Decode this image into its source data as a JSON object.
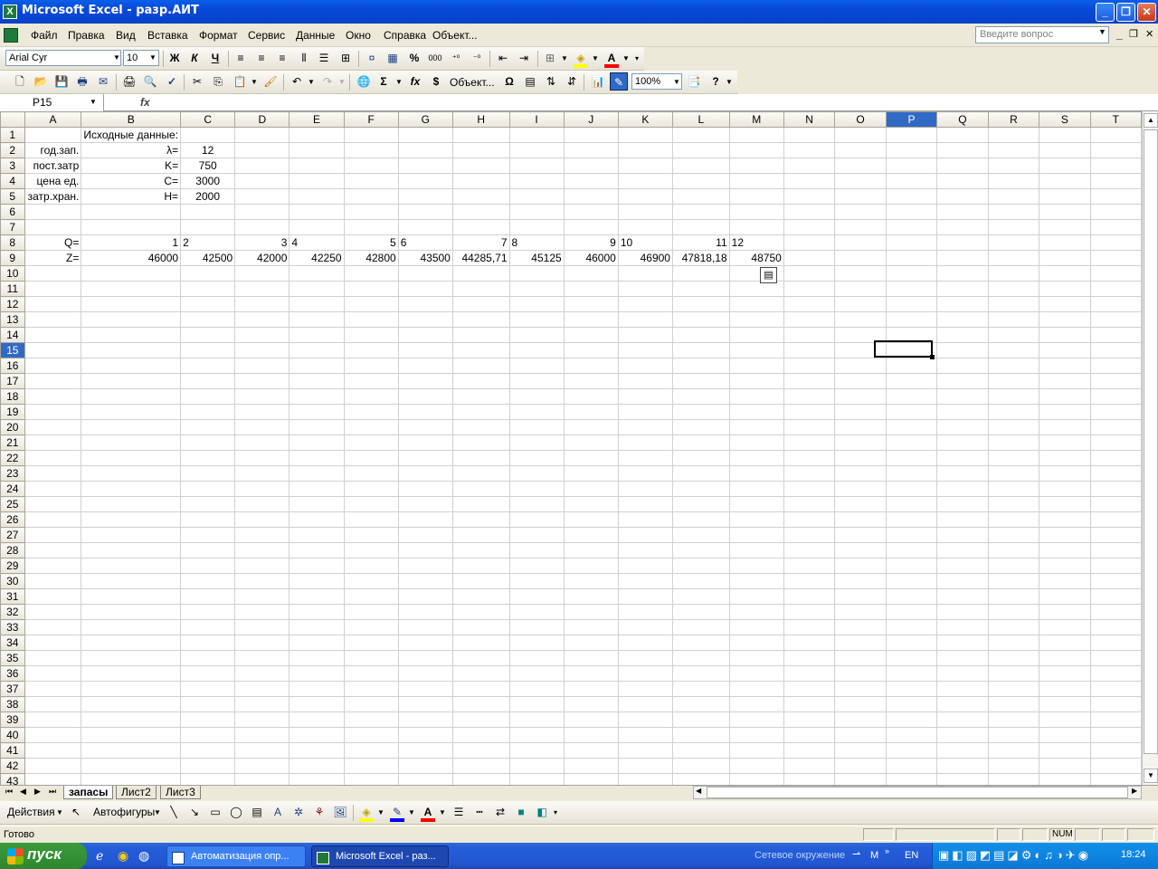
{
  "window": {
    "title": "Microsoft Excel - разр.АИТ",
    "app_icon": "X",
    "controls": {
      "minimize": "_",
      "maximize": "❐",
      "close": "✕"
    }
  },
  "menu": {
    "items": [
      "Файл",
      "Правка",
      "Вид",
      "Вставка",
      "Формат",
      "Сервис",
      "Данные",
      "Окно",
      "Справка",
      "Объект..."
    ],
    "help_placeholder": "Введите вопрос",
    "doc_controls": [
      "_",
      "❐",
      "✕"
    ]
  },
  "format_toolbar": {
    "font": "Arial Cyr",
    "size": "10",
    "bold": "Ж",
    "italic": "К",
    "underline": "Ч",
    "percent": "%",
    "thousands": "000"
  },
  "standard_toolbar": {
    "sum": "Σ",
    "fx": "fx",
    "object": "Объект...",
    "omega": "Ω",
    "zoom": "100%"
  },
  "formula_bar": {
    "name_box": "P15",
    "fx": "fx",
    "content": ""
  },
  "sheet": {
    "columns": [
      "A",
      "B",
      "C",
      "D",
      "E",
      "F",
      "G",
      "H",
      "I",
      "J",
      "K",
      "L",
      "M",
      "N",
      "O",
      "P",
      "Q",
      "R",
      "S",
      "T"
    ],
    "selected_column": "P",
    "selected_row": 15,
    "row_count": 43,
    "cells": {
      "r1": {
        "B": "Исходные данные:"
      },
      "r2": {
        "A": "год.зап.",
        "B": "λ=",
        "C": "12"
      },
      "r3": {
        "A": "пост.затр",
        "B": "K=",
        "C": "750"
      },
      "r4": {
        "A": "цена ед.",
        "B": "C=",
        "C": "3000"
      },
      "r5": {
        "A": "затр.хран.",
        "B": "H=",
        "C": "2000"
      },
      "r8": {
        "A": "Q=",
        "B": "1",
        "C": "2",
        "D": "3",
        "E": "4",
        "F": "5",
        "G": "6",
        "H": "7",
        "I": "8",
        "J": "9",
        "K": "10",
        "L": "11",
        "M": "12"
      },
      "r9": {
        "A": "Z=",
        "B": "46000",
        "C": "42500",
        "D": "42000",
        "E": "42250",
        "F": "42800",
        "G": "43500",
        "H": "44285,71",
        "I": "45125",
        "J": "46000",
        "K": "46900",
        "L": "47818,18",
        "M": "48750"
      }
    }
  },
  "sheet_tabs": [
    "запасы",
    "Лист2",
    "Лист3"
  ],
  "active_tab": "запасы",
  "drawing_toolbar": {
    "actions": "Действия",
    "autoshapes": "Автофигуры"
  },
  "status": {
    "text": "Готово",
    "num": "NUM"
  },
  "taskbar": {
    "start": "пуск",
    "tasks": [
      "Автоматизация опр...",
      "Microsoft Excel - раз..."
    ],
    "network": "Сетевое окружение",
    "lang": "EN",
    "clock": "18:24",
    "m_label": "M"
  }
}
